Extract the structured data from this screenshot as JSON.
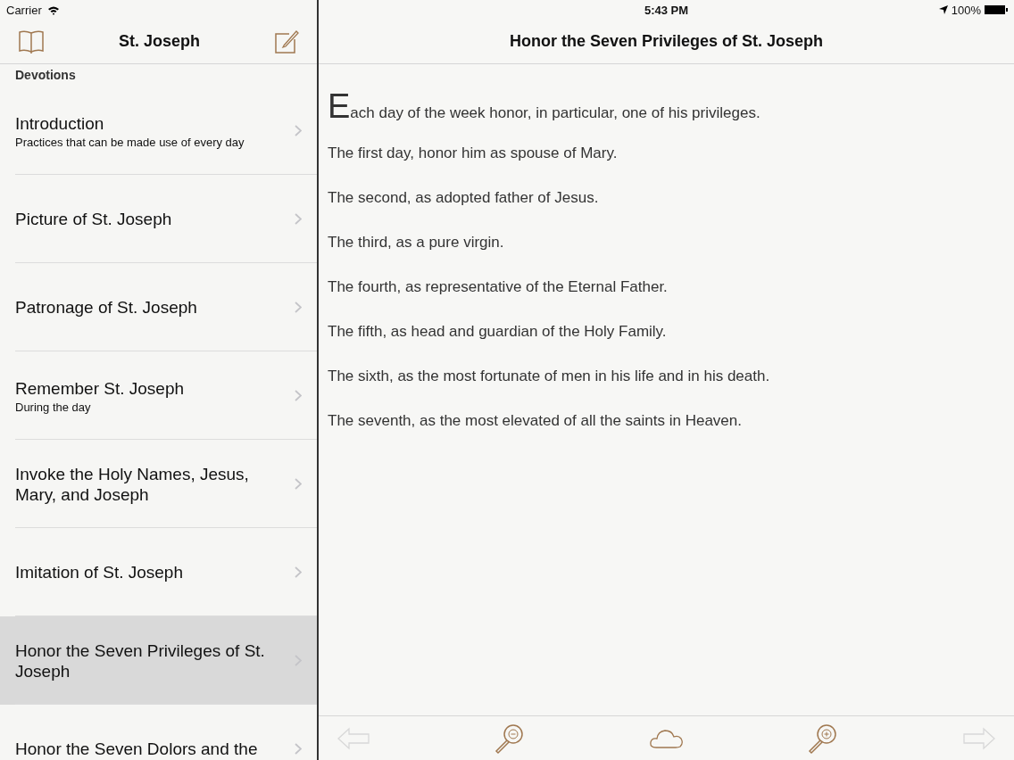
{
  "status_bar": {
    "carrier": "Carrier",
    "time": "5:43 PM",
    "battery": "100%"
  },
  "sidebar": {
    "title": "St. Joseph",
    "section": "Devotions",
    "items": [
      {
        "title": "Introduction",
        "subtitle": "Practices that can be made use of every day",
        "selected": false
      },
      {
        "title": "Picture of St. Joseph",
        "selected": false
      },
      {
        "title": "Patronage of St. Joseph",
        "selected": false
      },
      {
        "title": "Remember St. Joseph",
        "subtitle": "During the day",
        "selected": false
      },
      {
        "title": "Invoke the Holy Names, Jesus, Mary, and Joseph",
        "selected": false
      },
      {
        "title": "Imitation of St. Joseph",
        "selected": false
      },
      {
        "title": "Honor the Seven Privileges of St. Joseph",
        "selected": true
      },
      {
        "title": "Honor the Seven Dolors and the",
        "selected": false
      }
    ]
  },
  "detail": {
    "title": "Honor the Seven Privileges of St. Joseph",
    "lead": {
      "initial": "E",
      "text": "ach day of the week honor, in particular, one of his privileges."
    },
    "paragraphs": [
      "The first day, honor him as spouse of Mary.",
      "The second, as adopted father of Jesus.",
      "The third, as a pure virgin.",
      "The fourth, as representative of the Eternal Father.",
      "The fifth, as head and guardian of the Holy Family.",
      "The sixth, as the most fortunate of men in his life and in his death.",
      "The seventh, as the most elevated of all the saints in Heaven."
    ]
  },
  "toolbar": [
    {
      "kind": "back",
      "disabled": true
    },
    {
      "kind": "zoom-out",
      "disabled": false
    },
    {
      "kind": "cloud",
      "disabled": false
    },
    {
      "kind": "zoom-in",
      "disabled": false
    },
    {
      "kind": "forward",
      "disabled": true
    }
  ]
}
